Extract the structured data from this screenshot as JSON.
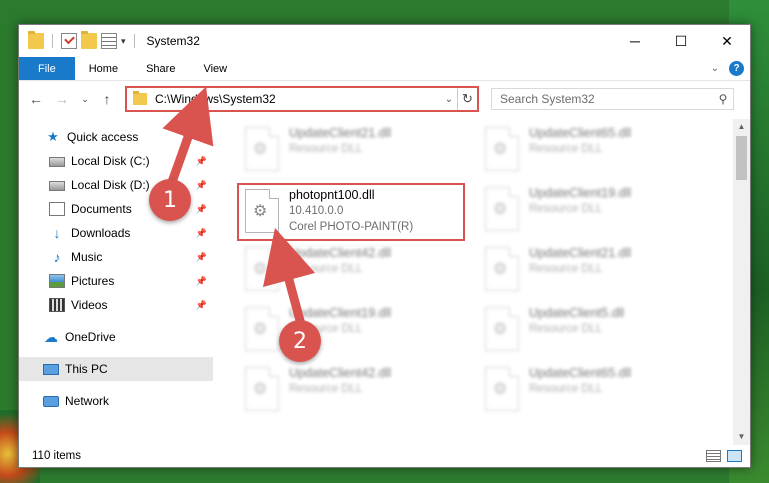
{
  "window": {
    "title": "System32",
    "controls": {
      "minimize": "─",
      "maximize": "☐",
      "close": "✕"
    }
  },
  "ribbon": {
    "tabs": [
      "File",
      "Home",
      "Share",
      "View"
    ],
    "help_label": "?"
  },
  "address_bar": {
    "path": "C:\\Windows\\System32",
    "search_placeholder": "Search System32"
  },
  "nav_pane": {
    "items": [
      {
        "label": "Quick access",
        "icon": "star-icon"
      },
      {
        "label": "Local Disk (C:)",
        "icon": "disk-icon",
        "pinned": true
      },
      {
        "label": "Local Disk (D:)",
        "icon": "disk-icon",
        "pinned": true
      },
      {
        "label": "Documents",
        "icon": "documents-icon",
        "pinned": true
      },
      {
        "label": "Downloads",
        "icon": "downloads-icon",
        "pinned": true
      },
      {
        "label": "Music",
        "icon": "music-icon",
        "pinned": true
      },
      {
        "label": "Pictures",
        "icon": "pictures-icon",
        "pinned": true
      },
      {
        "label": "Videos",
        "icon": "videos-icon",
        "pinned": true
      },
      {
        "label": "OneDrive",
        "icon": "cloud-icon"
      },
      {
        "label": "This PC",
        "icon": "pc-icon",
        "selected": true
      },
      {
        "label": "Network",
        "icon": "network-icon"
      }
    ]
  },
  "files": [
    {
      "name": "UpdateClient21.dll",
      "type": "Resource DLL"
    },
    {
      "name": "UpdateClient65.dll",
      "type": "Resource DLL"
    },
    {
      "name": "photopnt100.dll",
      "version": "10.410.0.0",
      "description": "Corel PHOTO-PAINT(R)",
      "highlighted": true
    },
    {
      "name": "UpdateClient19.dll",
      "type": "Resource DLL"
    },
    {
      "name": "UpdateClient42.dll",
      "type": "Resource DLL"
    },
    {
      "name": "UpdateClient21.dll",
      "type": "Resource DLL"
    },
    {
      "name": "UpdateClient19.dll",
      "type": "Resource DLL"
    },
    {
      "name": "UpdateClient5.dll",
      "type": "Resource DLL"
    },
    {
      "name": "UpdateClient42.dll",
      "type": "Resource DLL"
    },
    {
      "name": "UpdateClient65.dll",
      "type": "Resource DLL"
    }
  ],
  "status": {
    "items_count": "110 items"
  },
  "annotations": {
    "step1": "1",
    "step2": "2"
  },
  "colors": {
    "accent": "#1979ca",
    "annotation": "#d9534f"
  }
}
